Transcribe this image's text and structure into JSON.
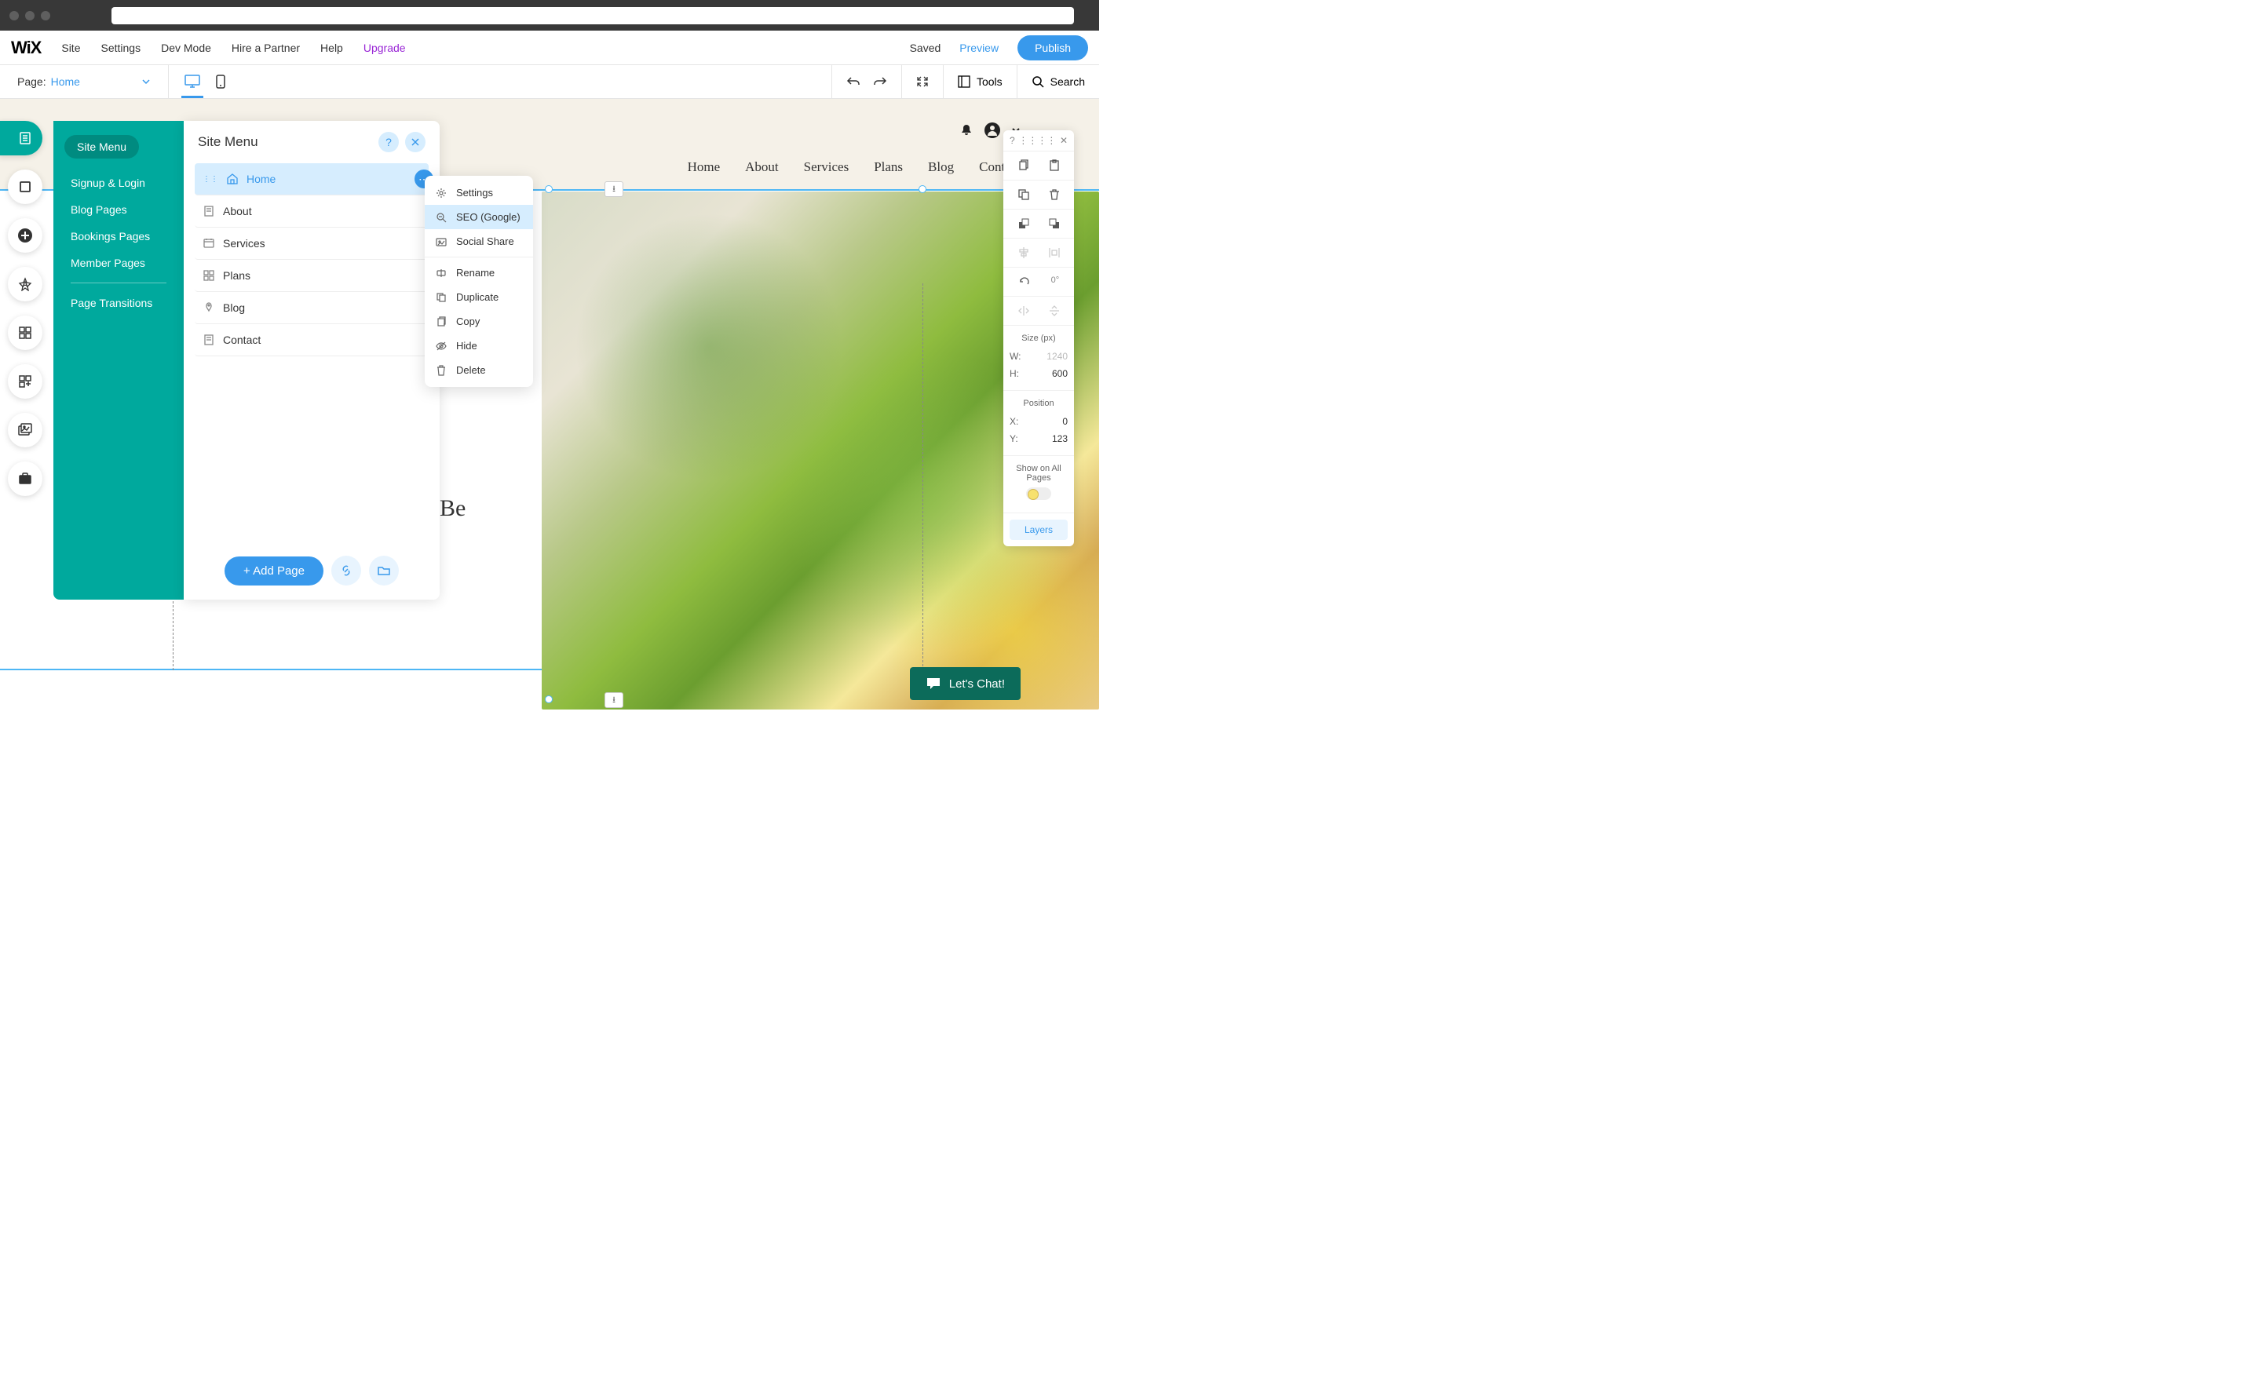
{
  "topMenu": {
    "items": [
      "Site",
      "Settings",
      "Dev Mode",
      "Hire a Partner",
      "Help"
    ],
    "upgrade": "Upgrade",
    "saved": "Saved",
    "preview": "Preview",
    "publish": "Publish"
  },
  "secondBar": {
    "pageLabel": "Page:",
    "pageName": "Home",
    "tools": "Tools",
    "search": "Search"
  },
  "tealPanel": {
    "active": "Site Menu",
    "items": [
      "Signup & Login",
      "Blog Pages",
      "Bookings Pages",
      "Member Pages"
    ],
    "afterDivider": [
      "Page Transitions"
    ]
  },
  "pagesPanel": {
    "title": "Site Menu",
    "pages": [
      {
        "label": "Home",
        "icon": "home",
        "selected": true
      },
      {
        "label": "About",
        "icon": "page"
      },
      {
        "label": "Services",
        "icon": "services"
      },
      {
        "label": "Plans",
        "icon": "plans"
      },
      {
        "label": "Blog",
        "icon": "blog"
      },
      {
        "label": "Contact",
        "icon": "page"
      }
    ],
    "addPage": "+ Add Page"
  },
  "contextMenu": {
    "group1": [
      "Settings",
      "SEO (Google)",
      "Social Share"
    ],
    "group2": [
      "Rename",
      "Duplicate",
      "Copy",
      "Hide",
      "Delete"
    ],
    "highlighted": "SEO (Google)"
  },
  "siteNav": [
    "Home",
    "About",
    "Services",
    "Plans",
    "Blog",
    "Contact"
  ],
  "heroText": "Be",
  "chat": "Let's Chat!",
  "props": {
    "rotation": "0°",
    "sizeLabel": "Size (px)",
    "w": "W:",
    "wVal": "1240",
    "h": "H:",
    "hVal": "600",
    "posLabel": "Position",
    "x": "X:",
    "xVal": "0",
    "y": "Y:",
    "yVal": "123",
    "showLabel": "Show on All Pages",
    "layers": "Layers"
  }
}
